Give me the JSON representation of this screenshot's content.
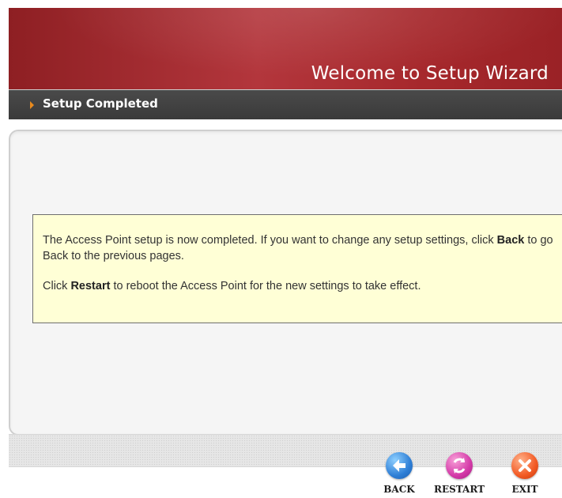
{
  "header": {
    "title": "Welcome to Setup Wizard"
  },
  "section": {
    "title": "Setup Completed"
  },
  "message": {
    "line1_pre": "The Access Point setup is now completed. If you want to change any setup settings, click ",
    "line1_bold": "Back",
    "line1_post": " to go Back to the previous pages.",
    "line2_pre": "Click ",
    "line2_bold": "Restart",
    "line2_post": " to reboot the Access Point for the new settings to take effect."
  },
  "buttons": {
    "back": "BACK",
    "restart": "RESTART",
    "exit": "EXIT"
  },
  "colors": {
    "header_red": "#a6282c",
    "titlebar_gray": "#404040",
    "message_bg": "#ffffd6",
    "arrow_orange": "#e98a1d"
  }
}
